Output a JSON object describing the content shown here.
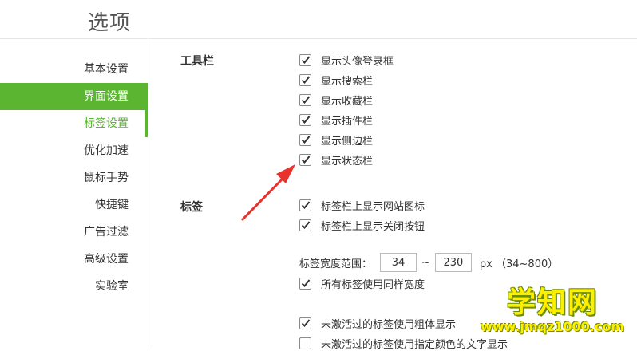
{
  "header": {
    "title": "选项"
  },
  "sidebar": {
    "items": [
      {
        "label": "基本设置"
      },
      {
        "label": "界面设置"
      },
      {
        "label": "标签设置"
      },
      {
        "label": "优化加速"
      },
      {
        "label": "鼠标手势"
      },
      {
        "label": "快捷键"
      },
      {
        "label": "广告过滤"
      },
      {
        "label": "高级设置"
      },
      {
        "label": "实验室"
      }
    ]
  },
  "toolbar_section": {
    "title": "工具栏",
    "options": [
      {
        "label": "显示头像登录框",
        "checked": true
      },
      {
        "label": "显示搜索栏",
        "checked": true
      },
      {
        "label": "显示收藏栏",
        "checked": true
      },
      {
        "label": "显示插件栏",
        "checked": true
      },
      {
        "label": "显示侧边栏",
        "checked": true
      },
      {
        "label": "显示状态栏",
        "checked": true
      }
    ]
  },
  "tabs_section": {
    "title": "标签",
    "options": [
      {
        "label": "标签栏上显示网站图标",
        "checked": true
      },
      {
        "label": "标签栏上显示关闭按钮",
        "checked": true
      }
    ],
    "width": {
      "label": "标签宽度范围：",
      "min": "34",
      "sep": "~",
      "max": "230",
      "unit": "px （34~800）"
    },
    "same_width": {
      "label": "所有标签使用同样宽度",
      "checked": true
    },
    "bold_inactive": {
      "label": "未激活过的标签使用粗体显示",
      "checked": true
    },
    "custom_color": {
      "label": "未激活过的标签使用指定颜色的文字显示",
      "checked": false
    }
  },
  "colors": {
    "accent": "#5cb531",
    "arrow": "#e8322e"
  },
  "watermark": {
    "title": "学知网",
    "url": "www.jmqz1000.com"
  }
}
